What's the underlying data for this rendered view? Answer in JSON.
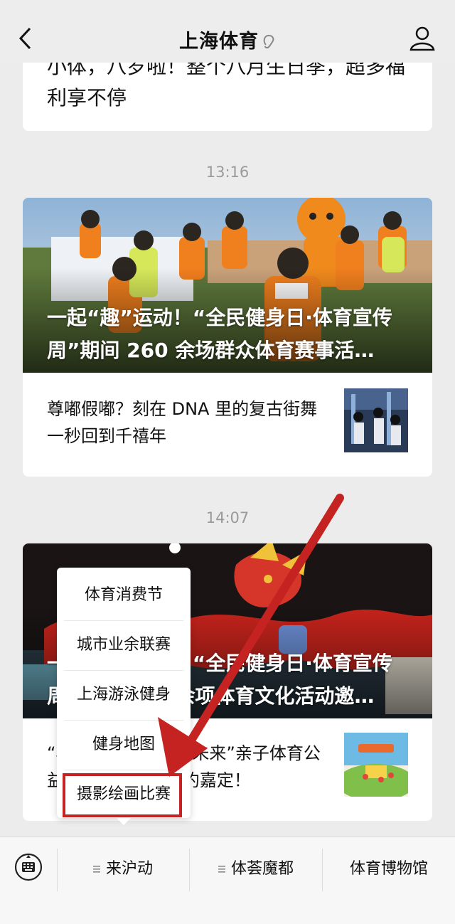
{
  "header": {
    "title": "上海体育"
  },
  "feed": {
    "top_article": {
      "title": "小体，八岁啦！整个八月生日季，超多福利享不停"
    },
    "group1": {
      "time": "13:16",
      "hero_title": "一起“趣”运动！“全民健身日·体育宣传周”期间 260 余场群众体育赛事活…",
      "article": "尊嘟假嘟？刻在 DNA 里的复古街舞 一秒回到千禧年"
    },
    "group2": {
      "time": "14:07",
      "hero_title": "一起“趣”运动！“全民健身日·体育宣传周”期间 260 余项体育文化活动邀…",
      "article": "“小手牵大手，跑向未来”亲子体育公益活动8月 飞扬相约嘉定！"
    }
  },
  "popup_menu": {
    "items": [
      "体育消费节",
      "城市业余联赛",
      "上海游泳健身",
      "健身地图",
      "摄影绘画比赛"
    ],
    "highlighted_index": 4
  },
  "bottom_menu": {
    "items": [
      {
        "label": "来沪动"
      },
      {
        "label": "体荟魔都"
      },
      {
        "label": "体育博物馆"
      }
    ]
  },
  "colors": {
    "annotation_red": "#c52222",
    "background": "#ececec"
  }
}
